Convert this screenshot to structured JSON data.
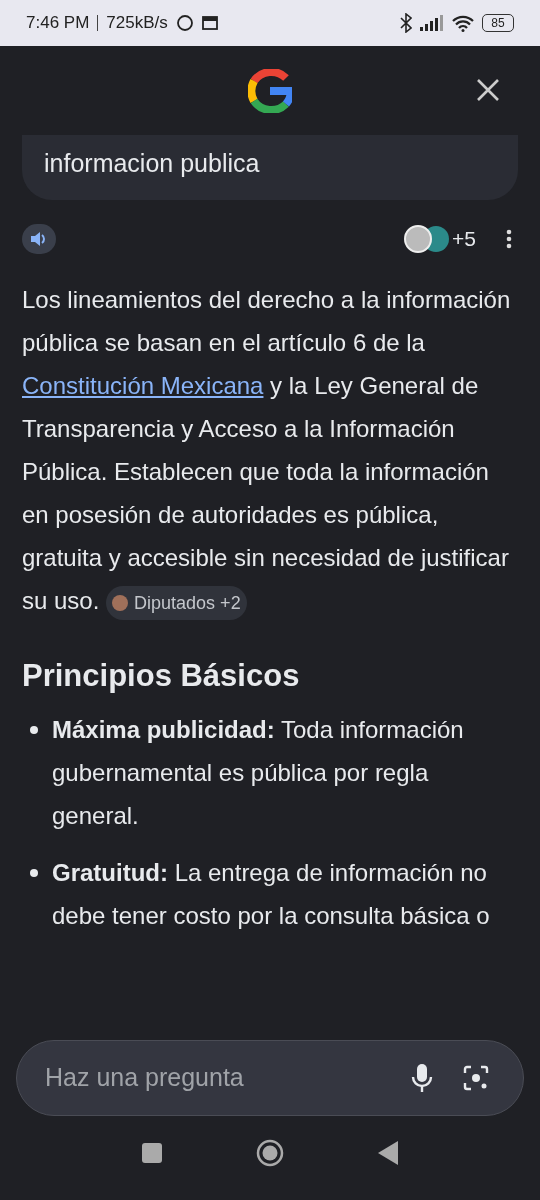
{
  "status_bar": {
    "time": "7:46 PM",
    "speed": "725kB/s",
    "battery": "85"
  },
  "query": "informacion publica",
  "sources": {
    "more": "+5"
  },
  "answer": {
    "before": "Los lineamientos del derecho a la información pública se basan en el artículo 6 de la ",
    "link": "Constitución Mexicana",
    "after": " y la Ley General de Transparencia y Acceso a la Información Pública. Establecen que toda la información en posesión de autoridades es pública, gratuita y accesible sin necesidad de justificar su uso.",
    "chip": "Diputados +2"
  },
  "heading": "Principios Básicos",
  "bullets": [
    "**Máxima publicidad:** Toda información gubernamental es pública por regla general.",
    "**Gratuitud:** La entrega de información no debe tener costo por la consulta básica o"
  ],
  "ask": {
    "placeholder": "Haz una pregunta"
  }
}
